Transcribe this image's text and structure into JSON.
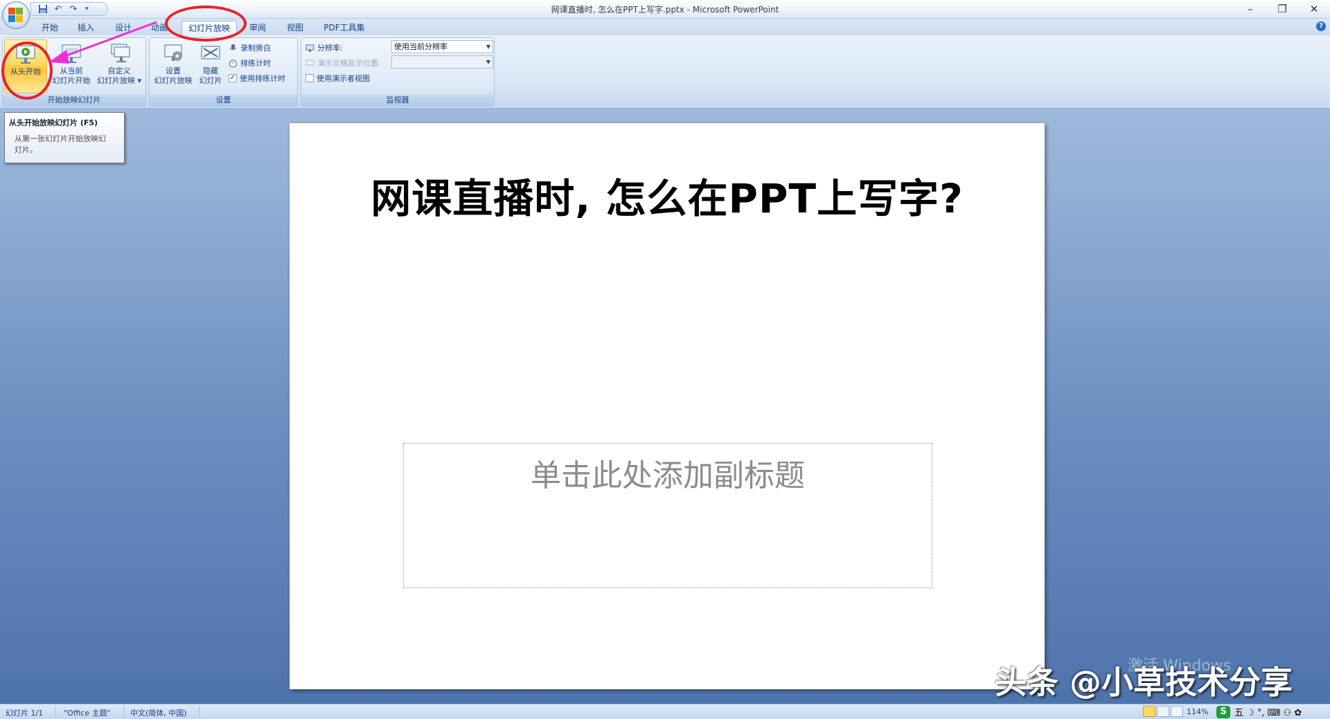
{
  "window": {
    "title": "网课直播时, 怎么在PPT上写字.pptx - Microsoft PowerPoint",
    "controls": [
      "–",
      "❐",
      "✕"
    ]
  },
  "quick_access": {
    "save_icon": "save-icon",
    "undo_icon": "undo-icon",
    "redo_icon": "redo-icon",
    "more": "▾"
  },
  "tabs": [
    "开始",
    "插入",
    "设计",
    "动画",
    "幻灯片放映",
    "审阅",
    "视图",
    "PDF工具集"
  ],
  "active_tab": "幻灯片放映",
  "ribbon": {
    "group_start": {
      "label": "开始放映幻灯片",
      "from_beginning": "从头开始",
      "from_current_line1": "从当前",
      "from_current_line2": "幻灯片开始",
      "custom_line1": "自定义",
      "custom_line2": "幻灯片放映 ▾"
    },
    "group_setup": {
      "label": "设置",
      "setup_line1": "设置",
      "setup_line2": "幻灯片放映",
      "hide_line1": "隐藏",
      "hide_line2": "幻灯片",
      "record_narration": "录制旁白",
      "rehearse_timings": "排练计时",
      "use_rehearsed_timings": "使用排练计时",
      "use_rehearsed_checked": "✓"
    },
    "group_monitors": {
      "label": "监视器",
      "resolution_label": "分辨率:",
      "resolution_value": "使用当前分辨率",
      "show_on_label": "演示文稿显示位置:",
      "show_on_value": "",
      "presenter_view": "使用演示者视图"
    }
  },
  "tooltip": {
    "title": "从头开始放映幻灯片 (F5)",
    "body_line1": "从第一张幻灯片开始放映幻",
    "body_line2": "灯片。"
  },
  "slide": {
    "title": "网课直播时, 怎么在PPT上写字?",
    "subtitle_placeholder": "单击此处添加副标题"
  },
  "statusbar": {
    "slide_count": "幻灯片 1/1",
    "theme": "\"Office 主题\"",
    "language": "中文(简体, 中国)",
    "zoom": "114%",
    "tray_s": "S",
    "tray_chars": "五 ☽ °, ⌨ ⚇ ✿"
  },
  "overlay": {
    "activate_windows": "激活 Windows",
    "watermark": "头条 @小草技术分享"
  },
  "colors": {
    "annotation_red": "#e8222c",
    "arrow_magenta": "#ee2fd6",
    "ribbon_text": "#15428b"
  }
}
